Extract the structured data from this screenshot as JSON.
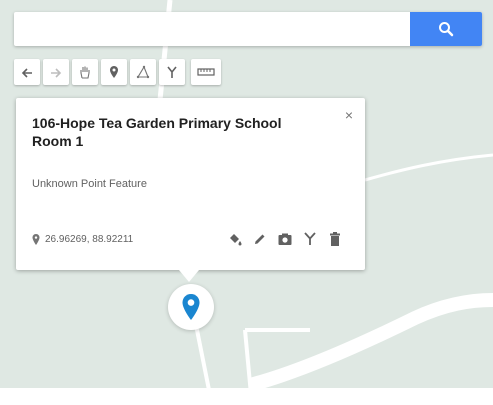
{
  "search": {
    "value": "",
    "placeholder": ""
  },
  "toolbar": {
    "tools": [
      {
        "name": "undo",
        "icon": "undo-icon"
      },
      {
        "name": "redo",
        "icon": "redo-icon"
      },
      {
        "name": "pan",
        "icon": "hand-icon"
      },
      {
        "name": "add-marker",
        "icon": "marker-icon"
      },
      {
        "name": "draw-line",
        "icon": "draw-line-icon"
      },
      {
        "name": "directions",
        "icon": "directions-icon"
      },
      {
        "name": "measure",
        "icon": "ruler-icon"
      }
    ]
  },
  "feature_card": {
    "title": "106-Hope Tea Garden Primary School Room 1",
    "close_label": "×",
    "subtitle": "Unknown Point Feature",
    "coordinates": "26.96269, 88.92211",
    "actions": [
      "style-icon",
      "edit-icon",
      "camera-icon",
      "directions-icon",
      "delete-icon"
    ]
  },
  "colors": {
    "accent": "#4285f4",
    "map_background": "#dfe8e3",
    "marker": "#1a86d0",
    "road": "#ffffff"
  }
}
